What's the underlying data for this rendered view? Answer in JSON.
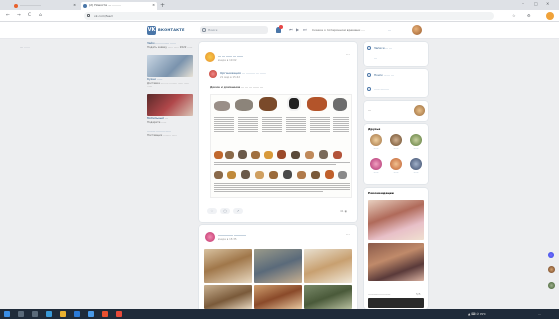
{
  "browser": {
    "tabs": [
      {
        "title": "…………………",
        "active": false
      },
      {
        "title": "(2) Новости — ………",
        "active": true
      }
    ],
    "new_tab": "+",
    "url": "vk.com/feed",
    "window_controls": [
      "–",
      "□",
      "✕"
    ],
    "nav": {
      "back": "←",
      "forward": "→",
      "reload": "C",
      "home": "⌂"
    }
  },
  "vk": {
    "logo": "VK",
    "brand": "ВКОНТАКТЕ",
    "search_placeholder": "Поиск",
    "notifications_badge": "",
    "player_text": "Сказка о потерянном времени ….",
    "user_name": "…",
    "left_menu_label": "— ……"
  },
  "ads": [
    {
      "title": "Займ …………… ……",
      "text": "Подать заявку …… …… 2022 ……"
    },
    {
      "title": "Кухни ……",
      "text": "Доставка ……… ……… …… …… ……"
    },
    {
      "title": "Мобильный …",
      "text": "Подарите ……"
    },
    {
      "title": "……… ……… ……",
      "text": "Поставщик ……… ……"
    }
  ],
  "feed": {
    "post1": {
      "group": "… … …… … ……",
      "date": "вчера в 10:02",
      "repost_from": "Организация … ……… … ……",
      "repost_date": "21 мар в 15:42",
      "text": "Дикие и домашние … … … …… …",
      "views": "41 ◉"
    },
    "post2": {
      "group": "…………… …………",
      "date": "вчера в 15:35"
    }
  },
  "actions": {
    "like": "♡",
    "comment": "◯",
    "share": "↗"
  },
  "right": {
    "menu": [
      {
        "label": "Записи … …"
      },
      {
        "label": "…"
      }
    ],
    "section2": [
      {
        "label": "Поиск … … …"
      },
      {
        "label": "…… ………"
      }
    ],
    "friends_title": "Друзья",
    "friend_names": [
      "……",
      "……",
      "……"
    ],
    "community_title": "……………………",
    "community_title2": "Рекомендации",
    "counter": "5/5"
  },
  "taskbar": {
    "tray_text": "▲ ⌨ ∅ РУС",
    "clock": "…"
  }
}
